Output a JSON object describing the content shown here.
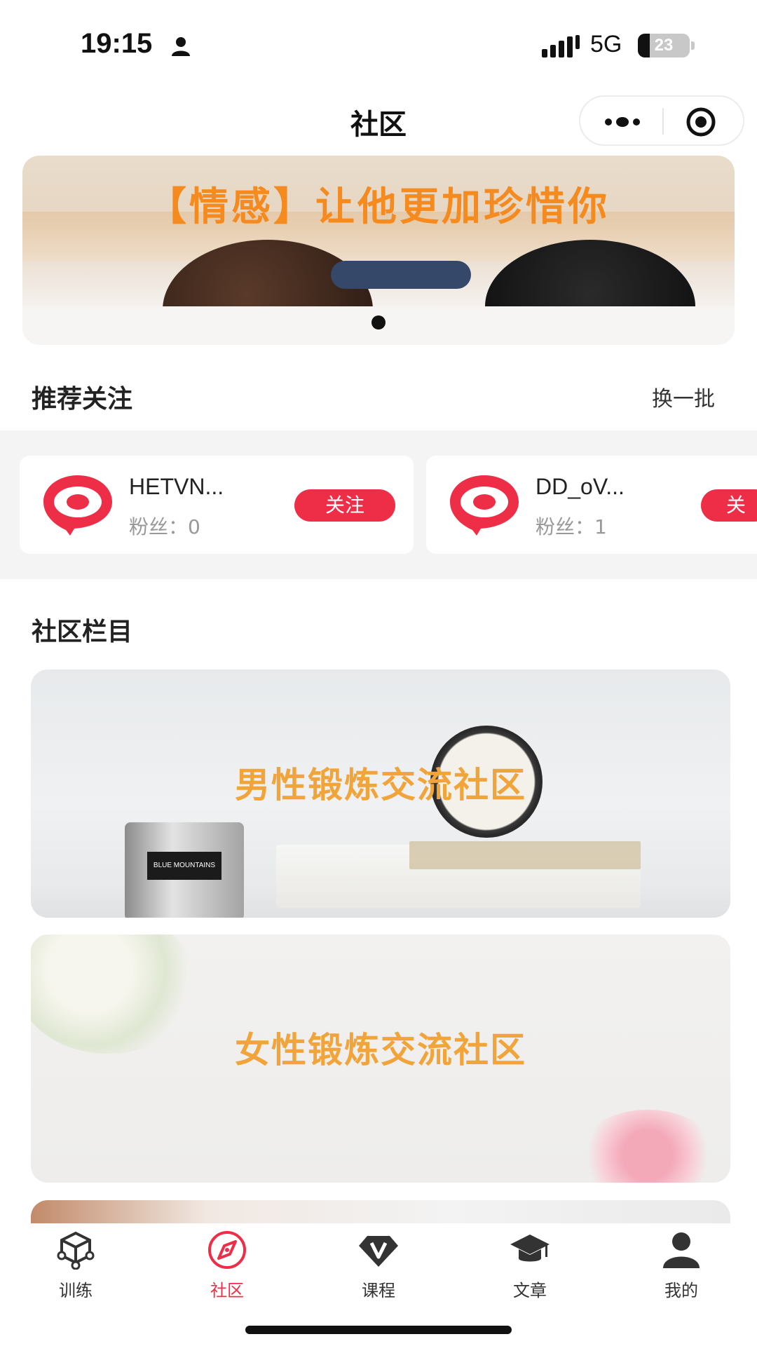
{
  "status_bar": {
    "time": "19:15",
    "network": "5G",
    "battery": 23,
    "battery_label": "23",
    "icons": [
      "user-icon",
      "signal-icon",
      "battery-icon"
    ]
  },
  "nav": {
    "title": "社区",
    "capsule_icons": [
      "more-dots-icon",
      "close-target-icon"
    ]
  },
  "banner": {
    "caption": "【情感】让他更加珍惜你",
    "pages": 1,
    "active_page": 1
  },
  "recommend": {
    "title": "推荐关注",
    "refresh_label": "换一批",
    "users": [
      {
        "name": "HETVN...",
        "fans_label": "粉丝：",
        "fans": "0",
        "follow_label": "关注"
      },
      {
        "name": "DD_oV...",
        "fans_label": "粉丝：",
        "fans": "1",
        "follow_label": "关"
      }
    ]
  },
  "columns": {
    "title": "社区栏目",
    "cards": [
      {
        "label": "男性锻炼交流社区"
      },
      {
        "label": "女性锻炼交流社区"
      }
    ],
    "can_tag": "BLUE MOUNTAINS"
  },
  "tabbar": {
    "active_color": "#ee2e47",
    "tabs": [
      {
        "label": "训练",
        "icon": "cube-network-icon",
        "active": false
      },
      {
        "label": "社区",
        "icon": "compass-icon",
        "active": true
      },
      {
        "label": "课程",
        "icon": "v-diamond-icon",
        "active": false
      },
      {
        "label": "文章",
        "icon": "graduation-cap-icon",
        "active": false
      },
      {
        "label": "我的",
        "icon": "person-icon",
        "active": false
      }
    ]
  }
}
